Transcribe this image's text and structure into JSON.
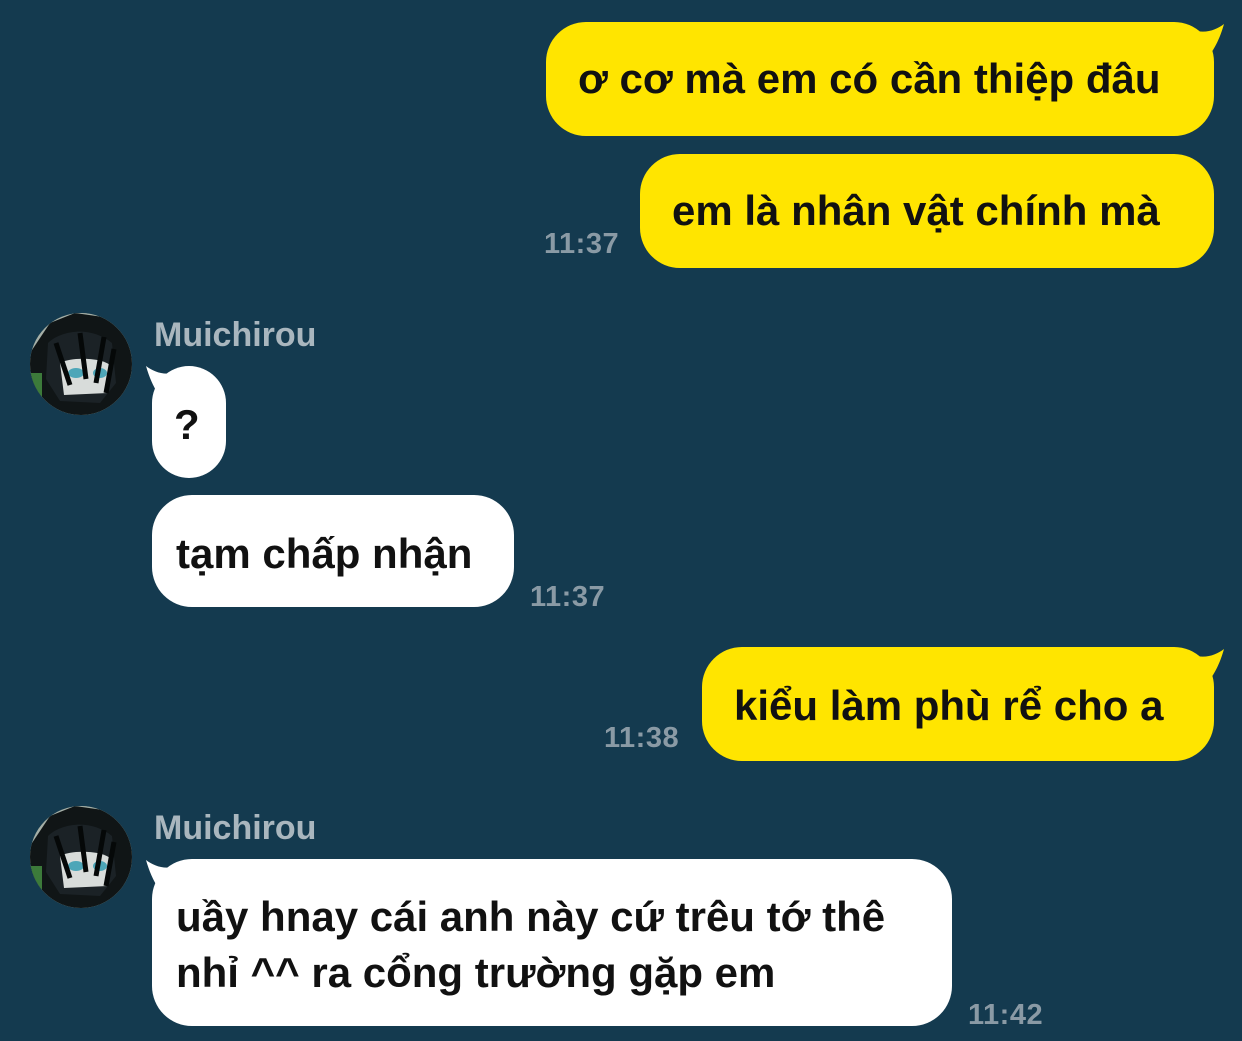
{
  "colors": {
    "background": "#143a4f",
    "outgoing_bubble": "#ffe500",
    "incoming_bubble": "#ffffff",
    "timestamp": "#8a9aa5",
    "sender_name": "#a9b6be"
  },
  "messages": [
    {
      "direction": "out",
      "text": "ơ cơ mà em có cần thiệp đâu"
    },
    {
      "direction": "out",
      "text": "em là nhân vật chính mà",
      "time": "11:37"
    },
    {
      "direction": "in",
      "sender": "Muichirou",
      "avatar_icon": "anime-character-avatar-icon",
      "text": "?"
    },
    {
      "direction": "in",
      "text": "tạm chấp nhận",
      "time": "11:37"
    },
    {
      "direction": "out",
      "text": "kiểu làm phù rể cho a",
      "time": "11:38"
    },
    {
      "direction": "in",
      "sender": "Muichirou",
      "avatar_icon": "anime-character-avatar-icon",
      "text": "uầy hnay cái anh này cứ trêu tớ thê nhỉ ^^ ra cổng trường gặp em",
      "time": "11:42"
    }
  ]
}
